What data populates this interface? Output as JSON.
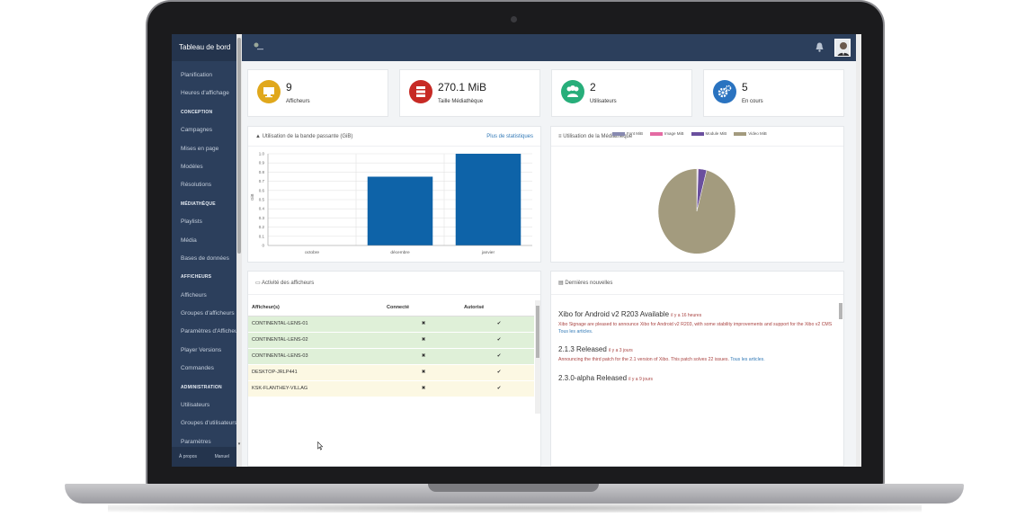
{
  "sidebar": {
    "brand": "Tableau de bord",
    "items": [
      {
        "label": "Planification",
        "section": false
      },
      {
        "label": "Heures d'affichage",
        "section": false
      },
      {
        "label": "CONCEPTION",
        "section": true
      },
      {
        "label": "Campagnes",
        "section": false
      },
      {
        "label": "Mises en page",
        "section": false
      },
      {
        "label": "Modèles",
        "section": false
      },
      {
        "label": "Résolutions",
        "section": false
      },
      {
        "label": "MÉDIATHÈQUE",
        "section": true
      },
      {
        "label": "Playlists",
        "section": false
      },
      {
        "label": "Média",
        "section": false
      },
      {
        "label": "Bases de données",
        "section": false
      },
      {
        "label": "AFFICHEURS",
        "section": true
      },
      {
        "label": "Afficheurs",
        "section": false
      },
      {
        "label": "Groupes d'afficheurs",
        "section": false
      },
      {
        "label": "Paramètres d'Afficheur",
        "section": false
      },
      {
        "label": "Player Versions",
        "section": false
      },
      {
        "label": "Commandes",
        "section": false
      },
      {
        "label": "ADMINISTRATION",
        "section": true
      },
      {
        "label": "Utilisateurs",
        "section": false
      },
      {
        "label": "Groupes d'utilisateurs",
        "section": false
      },
      {
        "label": "Paramètres",
        "section": false
      }
    ],
    "footer_about": "À propos",
    "footer_manual": "Manuel"
  },
  "stats": [
    {
      "value": "9",
      "label": "Afficheurs",
      "color": "#e0a81c",
      "icon": "monitor-icon"
    },
    {
      "value": "270.1 MiB",
      "label": "Taille Médiathèque",
      "color": "#c72a25",
      "icon": "server-icon"
    },
    {
      "value": "2",
      "label": "Utilisateurs",
      "color": "#27ae7a",
      "icon": "users-icon"
    },
    {
      "value": "5",
      "label": "En cours",
      "color": "#2a73c0",
      "icon": "cogs-icon"
    }
  ],
  "bandwidth": {
    "title": "Utilisation de la bande passante (GiB)",
    "link": "Plus de statistiques"
  },
  "library": {
    "title": "Utilisation de la Médiathèque"
  },
  "chart_data": [
    {
      "type": "bar",
      "categories": [
        "octobre",
        "décembre",
        "janvier"
      ],
      "values": [
        0,
        0.75,
        1.0
      ],
      "ylabel": "GiB",
      "ylim": [
        0,
        1.0
      ],
      "yticks": [
        "0",
        "0.1",
        "0.2",
        "0.3",
        "0.4",
        "0.5",
        "0.6",
        "0.7",
        "0.8",
        "0.9",
        "1.0"
      ],
      "color": "#0e63a8",
      "grid": true
    },
    {
      "type": "pie",
      "labels": [
        "Font MiB",
        "Image MiB",
        "Module MiB",
        "Video MiB"
      ],
      "values": [
        0.3,
        0.3,
        3.5,
        95.9
      ],
      "colors": [
        "#8789b0",
        "#e46ba3",
        "#6a4f9e",
        "#a39b7e"
      ],
      "legend": "top"
    }
  ],
  "activity": {
    "title": "Activité des afficheurs",
    "headers": [
      "Afficheur(s)",
      "Connecté",
      "Autorisé"
    ],
    "rows": [
      {
        "name": "CONTINENTAL-LENS-01",
        "connected": "✖",
        "authorized": "✔",
        "status": "ok"
      },
      {
        "name": "CONTINENTAL-LENS-02",
        "connected": "✖",
        "authorized": "✔",
        "status": "ok"
      },
      {
        "name": "CONTINENTAL-LENS-03",
        "connected": "✖",
        "authorized": "✔",
        "status": "ok"
      },
      {
        "name": "DESKTOP-JRLP441",
        "connected": "✖",
        "authorized": "✔",
        "status": "warn"
      },
      {
        "name": "KSK-FLANTHEY-VILLAG",
        "connected": "✖",
        "authorized": "✔",
        "status": "warn"
      }
    ]
  },
  "news": {
    "title": "Dernières nouvelles",
    "items": [
      {
        "headline": "Xibo for Android v2 R203 Available",
        "age": "il y a 16 heures",
        "body": "Xibo Signage are pleased to announce Xibo for Android v2 R203, with some stability improvements and support for the Xibo v2 CMS",
        "link": "Tous les articles."
      },
      {
        "headline": "2.1.3 Released",
        "age": "il y a 3 jours",
        "body": "Announcing the third patch for the 2.1 version of Xibo. This patch solves 22 issues.",
        "link": "Tous les articles."
      },
      {
        "headline": "2.3.0-alpha Released",
        "age": "il y a 9 jours",
        "body": "",
        "link": ""
      }
    ]
  }
}
